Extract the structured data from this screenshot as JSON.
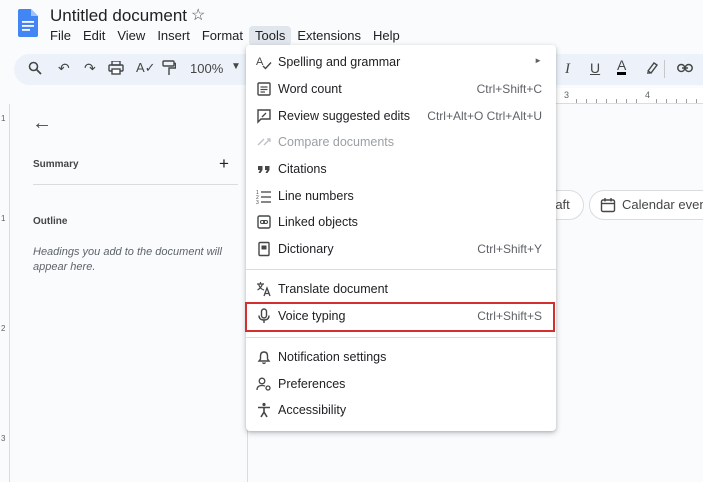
{
  "doc": {
    "title": "Untitled document"
  },
  "menubar": [
    "File",
    "Edit",
    "View",
    "Insert",
    "Format",
    "Tools",
    "Extensions",
    "Help"
  ],
  "toolbar": {
    "zoom": "100%"
  },
  "ruler": {
    "numbers": [
      "3",
      "4"
    ]
  },
  "vruler": {
    "numbers": [
      "1",
      "1",
      "2",
      "3"
    ]
  },
  "outline": {
    "summary_label": "Summary",
    "summary_add": "+",
    "outline_label": "Outline",
    "hint": "Headings you add to the document will appear here."
  },
  "chips": {
    "draft": "raft",
    "calendar": "Calendar event"
  },
  "tools_menu": {
    "items": [
      {
        "label": "Spelling and grammar",
        "shortcut": "",
        "icon": "spellcheck-icon",
        "submenu": true,
        "disabled": false
      },
      {
        "label": "Word count",
        "shortcut": "Ctrl+Shift+C",
        "icon": "word-count-icon",
        "submenu": false,
        "disabled": false
      },
      {
        "label": "Review suggested edits",
        "shortcut": "Ctrl+Alt+O Ctrl+Alt+U",
        "icon": "rate-review-icon",
        "submenu": false,
        "disabled": false
      },
      {
        "label": "Compare documents",
        "shortcut": "",
        "icon": "compare-icon",
        "submenu": false,
        "disabled": true
      },
      {
        "label": "Citations",
        "shortcut": "",
        "icon": "quote-icon",
        "submenu": false,
        "disabled": false
      },
      {
        "label": "Line numbers",
        "shortcut": "",
        "icon": "line-numbers-icon",
        "submenu": false,
        "disabled": false
      },
      {
        "label": "Linked objects",
        "shortcut": "",
        "icon": "linked-objects-icon",
        "submenu": false,
        "disabled": false
      },
      {
        "label": "Dictionary",
        "shortcut": "Ctrl+Shift+Y",
        "icon": "dictionary-icon",
        "submenu": false,
        "disabled": false
      },
      {
        "label": "Translate document",
        "shortcut": "",
        "icon": "translate-icon",
        "submenu": false,
        "disabled": false
      },
      {
        "label": "Voice typing",
        "shortcut": "Ctrl+Shift+S",
        "icon": "mic-icon",
        "submenu": false,
        "disabled": false
      },
      {
        "label": "Notification settings",
        "shortcut": "",
        "icon": "bell-icon",
        "submenu": false,
        "disabled": false
      },
      {
        "label": "Preferences",
        "shortcut": "",
        "icon": "manage-accounts-icon",
        "submenu": false,
        "disabled": false
      },
      {
        "label": "Accessibility",
        "shortcut": "",
        "icon": "accessibility-icon",
        "submenu": false,
        "disabled": false
      }
    ]
  },
  "colors": {
    "brand_blue": "#4285f4",
    "highlight_red": "#d32f2f",
    "toolbar_bg": "#edf2fa"
  }
}
